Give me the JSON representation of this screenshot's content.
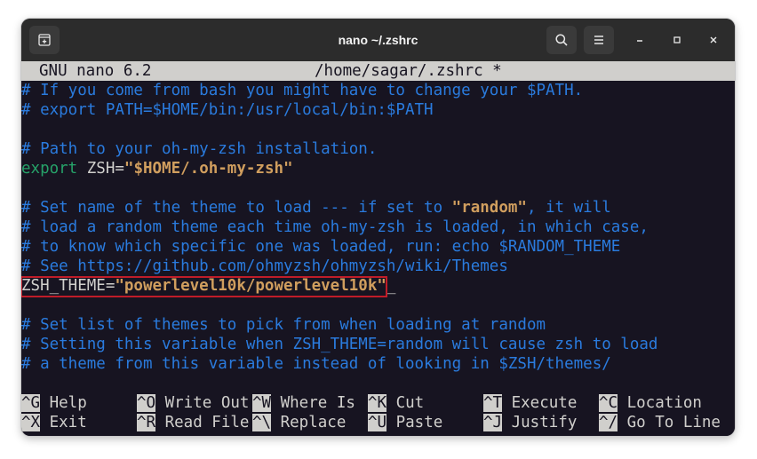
{
  "window": {
    "title": "nano ~/.zshrc"
  },
  "titlebar_icons": {
    "new_tab": "new-tab-icon",
    "search": "search-icon",
    "menu": "hamburger-menu-icon",
    "minimize": "minimize-icon",
    "maximize": "maximize-icon",
    "close": "close-icon"
  },
  "nano": {
    "version": "GNU nano 6.2",
    "file": "/home/sagar/.zshrc *"
  },
  "editor": {
    "l1": "# If you come from bash you might have to change your $PATH.",
    "l2": "# export PATH=$HOME/bin:/usr/local/bin:$PATH",
    "l4": "# Path to your oh-my-zsh installation.",
    "l5_kw": "export",
    "l5_var": " ZSH=",
    "l5_str": "\"$HOME/.oh-my-zsh\"",
    "l7_a": "# Set name of the theme to load --- if set to ",
    "l7_str": "\"random\"",
    "l7_b": ", it will",
    "l8": "# load a random theme each time oh-my-zsh is loaded, in which case,",
    "l9": "# to know which specific one was loaded, run: echo $RANDOM_THEME",
    "l10": "# See https://github.com/ohmyzsh/ohmyzsh/wiki/Themes",
    "l11_var": "ZSH_THEME=",
    "l11_str": "\"powerlevel10k/powerlevel10k\"",
    "l11_cursor": "_",
    "l13": "# Set list of themes to pick from when loading at random",
    "l14": "# Setting this variable when ZSH_THEME=random will cause zsh to load",
    "l15": "# a theme from this variable instead of looking in $ZSH/themes/"
  },
  "shortcuts": {
    "row1": [
      {
        "key": "^G",
        "label": " Help"
      },
      {
        "key": "^O",
        "label": " Write Out"
      },
      {
        "key": "^W",
        "label": " Where Is"
      },
      {
        "key": "^K",
        "label": " Cut"
      },
      {
        "key": "^T",
        "label": " Execute"
      },
      {
        "key": "^C",
        "label": " Location"
      }
    ],
    "row2": [
      {
        "key": "^X",
        "label": " Exit"
      },
      {
        "key": "^R",
        "label": " Read File"
      },
      {
        "key": "^\\",
        "label": " Replace"
      },
      {
        "key": "^U",
        "label": " Paste"
      },
      {
        "key": "^J",
        "label": " Justify"
      },
      {
        "key": "^/",
        "label": " Go To Line"
      }
    ]
  },
  "colors": {
    "terminal_bg": "#171421",
    "comment": "#2a7bde",
    "keyword": "#26a269",
    "string": "#d09e5e",
    "highlight_box": "#c01c28"
  }
}
